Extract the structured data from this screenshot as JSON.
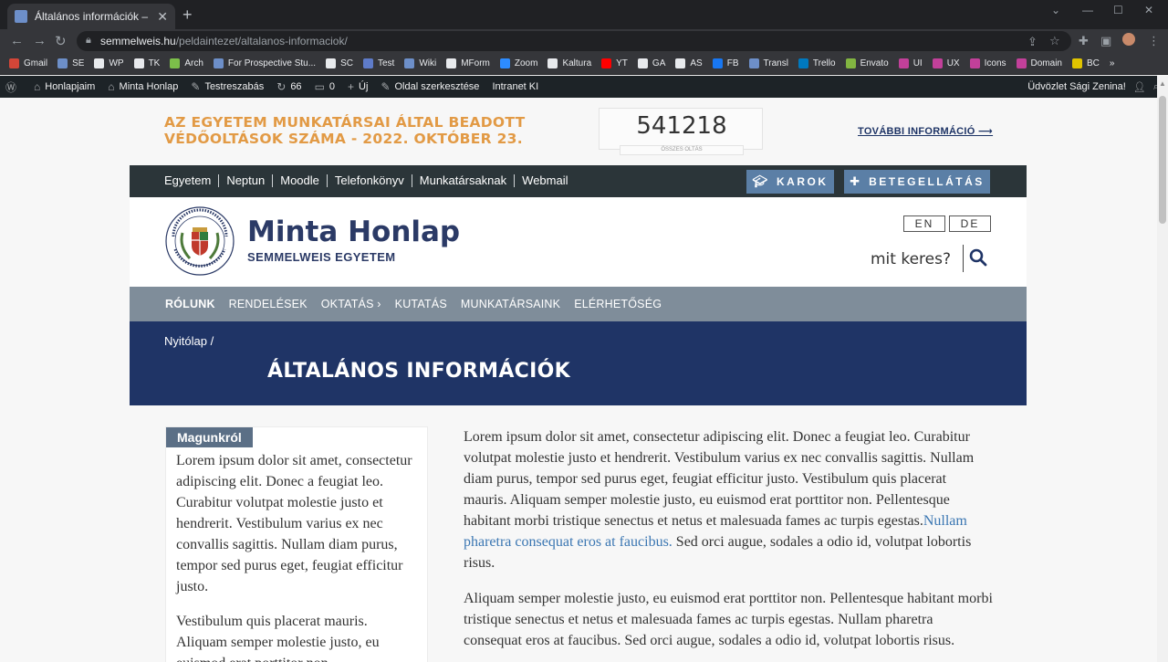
{
  "browser": {
    "tab_title": "Általános információk – Minta Ho",
    "tab_close": "✕",
    "new_tab": "+",
    "url_host": "semmelweis.hu",
    "url_path": "/peldaintezet/altalanos-informaciok/",
    "bookmarks": [
      {
        "label": "Gmail",
        "color": "#d44638"
      },
      {
        "label": "SE",
        "color": "#6d8fc9"
      },
      {
        "label": "WP",
        "color": "#e8eaed"
      },
      {
        "label": "TK",
        "color": "#e8eaed"
      },
      {
        "label": "Arch",
        "color": "#7cbf4a"
      },
      {
        "label": "For Prospective Stu...",
        "color": "#6d8fc9"
      },
      {
        "label": "SC",
        "color": "#e8eaed"
      },
      {
        "label": "Test",
        "color": "#5e7bc9"
      },
      {
        "label": "Wiki",
        "color": "#6d8fc9"
      },
      {
        "label": "MForm",
        "color": "#e8eaed"
      },
      {
        "label": "Zoom",
        "color": "#2d8cff"
      },
      {
        "label": "Kaltura",
        "color": "#e8eaed"
      },
      {
        "label": "YT",
        "color": "#ff0000"
      },
      {
        "label": "GA",
        "color": "#e8eaed"
      },
      {
        "label": "AS",
        "color": "#e8eaed"
      },
      {
        "label": "FB",
        "color": "#1877f2"
      },
      {
        "label": "Transl",
        "color": "#6d8fc9"
      },
      {
        "label": "Trello",
        "color": "#0079bf"
      },
      {
        "label": "Envato",
        "color": "#82b541"
      },
      {
        "label": "UI",
        "color": "#c2409a"
      },
      {
        "label": "UX",
        "color": "#c2409a"
      },
      {
        "label": "Icons",
        "color": "#c2409a"
      },
      {
        "label": "Domain",
        "color": "#c2409a"
      },
      {
        "label": "BC",
        "color": "#e0c400"
      }
    ],
    "bookmarks_more": "»"
  },
  "wpbar": {
    "items": [
      {
        "icon": "⌂",
        "label": "Honlapjaim"
      },
      {
        "icon": "⌂",
        "label": "Minta Honlap"
      },
      {
        "icon": "✎",
        "label": "Testreszabás"
      },
      {
        "icon": "↻",
        "label": "66"
      },
      {
        "icon": "▭",
        "label": "0"
      },
      {
        "icon": "+",
        "label": "Új"
      },
      {
        "icon": "✎",
        "label": "Oldal szerkesztése"
      },
      {
        "icon": "",
        "label": "Intranet KI"
      }
    ],
    "greeting": "Üdvözlet Sági Zenina!"
  },
  "vax": {
    "title": "AZ EGYETEM MUNKATÁRSAI ÁLTAL BEADOTT VÉDŐOLTÁSOK SZÁMA - 2022. OKTÓBER 23.",
    "count": "541218",
    "count_label": "ÖSSZES OLTÁS",
    "more": "TOVÁBBI INFORMÁCIÓ ⟶"
  },
  "topnav": {
    "links": [
      "Egyetem",
      "Neptun",
      "Moodle",
      "Telefonkönyv",
      "Munkatársaknak",
      "Webmail"
    ],
    "karok": "KAROK",
    "betegellatas": "BETEGELLÁTÁS"
  },
  "header": {
    "title": "Minta Honlap",
    "subtitle": "SEMMELWEIS EGYETEM",
    "lang_en": "EN",
    "lang_de": "DE",
    "search_label": "mit keres?"
  },
  "mainnav": {
    "items": [
      "RÓLUNK",
      "RENDELÉSEK",
      "OKTATÁS ›",
      "KUTATÁS",
      "MUNKATÁRSAINK",
      "ELÉRHETŐSÉG"
    ]
  },
  "hero": {
    "breadcrumb": "Nyitólap /",
    "title": "ÁLTALÁNOS INFORMÁCIÓK"
  },
  "sidebar": {
    "badge": "Magunkról",
    "p1": "Lorem ipsum dolor sit amet, consectetur adipiscing elit. Donec a feugiat leo. Curabitur volutpat molestie justo et hendrerit. Vestibulum varius ex nec convallis sagittis. Nullam diam purus, tempor sed purus eget, feugiat efficitur justo.",
    "p2": "Vestibulum quis placerat mauris. Aliquam semper molestie justo, eu euismod erat porttitor non."
  },
  "content": {
    "p1_a": "Lorem ipsum dolor sit amet, consectetur adipiscing elit. Donec a feugiat leo. Curabitur volutpat molestie justo et hendrerit. Vestibulum varius ex nec convallis sagittis. Nullam diam purus, tempor sed purus eget, feugiat efficitur justo. Vestibulum quis placerat mauris. Aliquam semper molestie justo, eu euismod erat porttitor non. Pellentesque habitant morbi tristique senectus et netus et malesuada fames ac turpis egestas.",
    "p1_link": "Nullam pharetra consequat eros at faucibus.",
    "p1_b": " Sed orci augue, sodales a odio id, volutpat lobortis risus.",
    "p2": "Aliquam semper molestie justo, eu euismod erat porttitor non. Pellentesque habitant morbi tristique senectus et netus et malesuada fames ac turpis egestas. Nullam pharetra consequat eros at faucibus. Sed orci augue, sodales a odio id, volutpat lobortis risus."
  }
}
